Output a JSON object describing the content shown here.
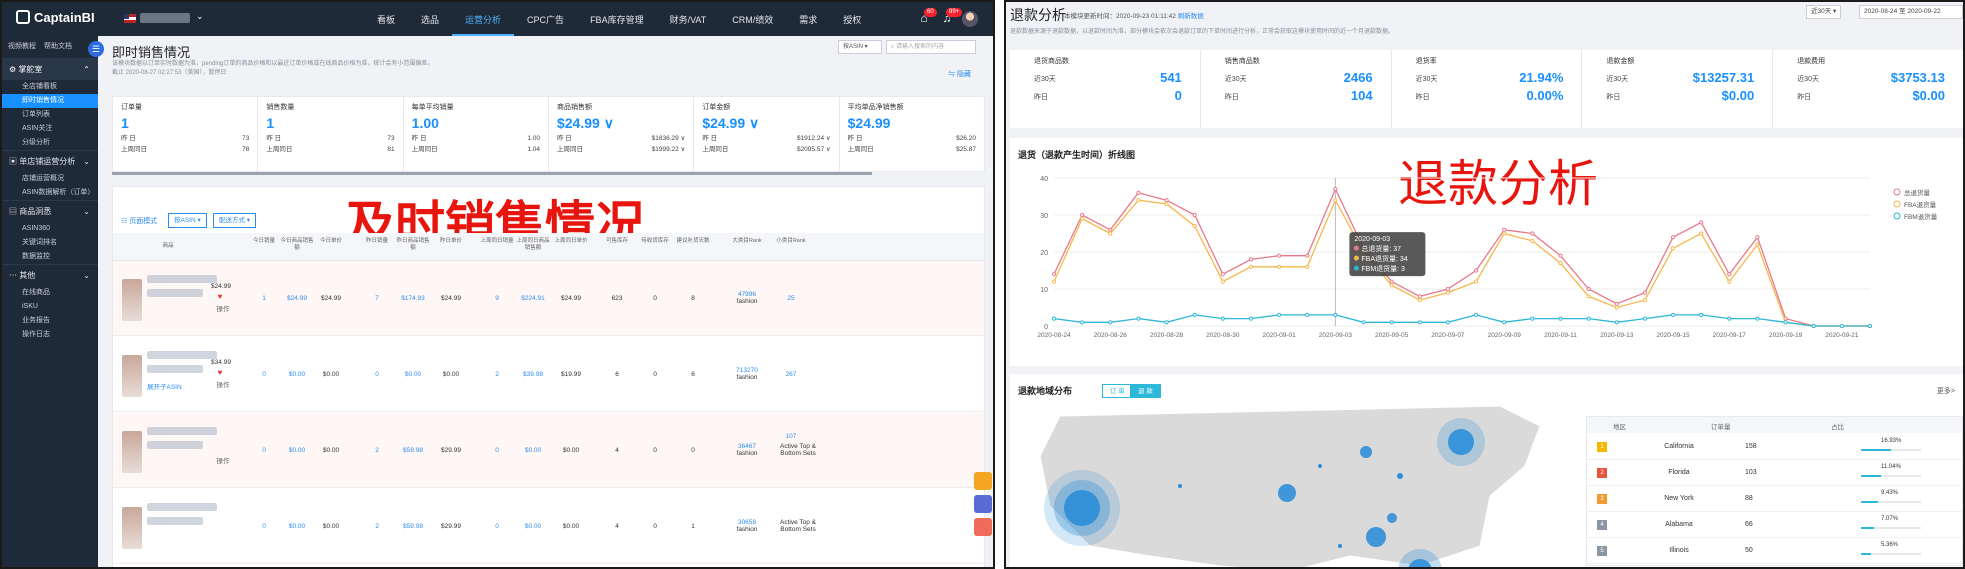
{
  "left": {
    "app": {
      "logo": "CaptainBI",
      "store": "████",
      "nav": [
        "看板",
        "选品",
        "运营分析",
        "CPC广告",
        "FBA库存管理",
        "财务/VAT",
        "CRM/绩效",
        "需求",
        "授权"
      ],
      "active_nav": "运营分析",
      "badge1": "60",
      "badge2": "99+"
    },
    "sidebar": {
      "top_links": [
        "视频教程",
        "帮助文档"
      ],
      "groups": [
        {
          "label": "掌舵室",
          "items": [
            "全店铺看板",
            "即时销售情况",
            "订单列表",
            "ASIN关注",
            "分级分析"
          ]
        },
        {
          "label": "单店铺运营分析",
          "items": [
            "店铺运营概况",
            "ASIN数据解析（订单）"
          ]
        },
        {
          "label": "商品洞悉",
          "items": [
            "ASIN360",
            "关键词排名",
            "数据监控"
          ]
        },
        {
          "label": "其他",
          "items": [
            "在线商品",
            "iSKU",
            "业务报告",
            "操作日志"
          ]
        }
      ],
      "active": "即时销售情况"
    },
    "page": {
      "title": "即时销售情况",
      "desc1": "该模块数据以订单实时数据为准，pending订单的商品价格和以最近订单价格或在线商品价格为准，统计会有小范围偏差。",
      "desc2": "截止 2020-08-27 02:27:53（美国），暂停日",
      "asin_select": "按ASIN",
      "search_placeholder": "请输入搜索的内容",
      "hide_label": "隐藏"
    },
    "kpis": [
      {
        "title": "订单量",
        "value": "1",
        "r1l": "昨 日",
        "r1v": "73",
        "r2l": "上周同日",
        "r2v": "78"
      },
      {
        "title": "销售数量",
        "value": "1",
        "r1l": "昨 日",
        "r1v": "73",
        "r2l": "上周同日",
        "r2v": "81"
      },
      {
        "title": "每单平均销量",
        "value": "1.00",
        "r1l": "昨 日",
        "r1v": "1.00",
        "r2l": "上周同日",
        "r2v": "1.04"
      },
      {
        "title": "商品销售额",
        "value": "$24.99 ∨",
        "r1l": "昨 日",
        "r1v": "$1836.29 ∨",
        "r2l": "上周同日",
        "r2v": "$1999.22 ∨"
      },
      {
        "title": "订单金额",
        "value": "$24.99 ∨",
        "r1l": "昨 日",
        "r1v": "$1912.24 ∨",
        "r2l": "上周同日",
        "r2v": "$2095.57 ∨"
      },
      {
        "title": "平均单品净销售额",
        "value": "$24.99",
        "r1l": "昨 日",
        "r1v": "$26.20",
        "r2l": "上周同日",
        "r2v": "$25.87"
      }
    ],
    "overlay": "及时销售情况",
    "table": {
      "btn_view": "页面模式",
      "btn_asin": "按ASIN ▾",
      "btn_ship": "配送方式 ▾",
      "headers": [
        "商品",
        "今日销量",
        "今日商品销售额",
        "今日单价",
        "昨日销量",
        "昨日商品销售额",
        "昨日单价",
        "上周同日销量",
        "上周同日商品销售额",
        "上周同日单价",
        "可售库存",
        "待收货库存",
        "建议补货天数",
        "大类目Rank",
        "小类目Rank"
      ],
      "rows": [
        {
          "price": "$24.99",
          "action": "操作",
          "cells": [
            "1",
            "$24.99",
            "$24.99",
            "7",
            "$174.93",
            "$24.99",
            "9",
            "$224.91",
            "$24.99",
            "623",
            "0",
            "8"
          ],
          "rank_big": "47996",
          "rank_big_cat": "fashion",
          "rank_small": "25",
          "extra": ""
        },
        {
          "price": "$34.99",
          "action": "操作",
          "cells": [
            "0",
            "$0.00",
            "$0.00",
            "0",
            "$0.00",
            "$0.00",
            "2",
            "$39.98",
            "$19.99",
            "6",
            "0",
            "6"
          ],
          "rank_big": "713270",
          "rank_big_cat": "fashion",
          "rank_small": "267",
          "extra": "展开子ASIN"
        },
        {
          "price": "",
          "action": "操作",
          "cells": [
            "0",
            "$0.00",
            "$0.00",
            "2",
            "$59.98",
            "$29.99",
            "0",
            "$0.00",
            "$0.00",
            "4",
            "0",
            "0"
          ],
          "rank_big": "36467",
          "rank_big_cat": "fashion",
          "rank_small": "107",
          "extra": "Active Top & Bottom Sets"
        },
        {
          "price": "",
          "action": "",
          "cells": [
            "0",
            "$0.00",
            "$0.00",
            "2",
            "$59.98",
            "$29.99",
            "0",
            "$0.00",
            "$0.00",
            "4",
            "0",
            "1"
          ],
          "rank_big": "30658",
          "rank_big_cat": "fashion",
          "rank_small": "",
          "extra": "Active Top & Bottom Sets"
        }
      ]
    }
  },
  "right": {
    "title": "退款分析",
    "update_label": "本模块更新时间：2020-09-23 01:11:42",
    "refresh": "刷新数据",
    "desc": "退款数据来源于退款数据，以退款时间为准，部分模块会依次会退款订单的下单时间进行分析，正常会获取这模块使用时间的近一个月退款数据。",
    "range_select": "近30天 ▾",
    "date_range": "2020-08-24 至 2020-09-22",
    "kpis": [
      {
        "title": "退货商品数",
        "l1": "近30天",
        "v1": "541",
        "l2": "昨日",
        "v2": "0"
      },
      {
        "title": "销售商品数",
        "l1": "近30天",
        "v1": "2466",
        "l2": "昨日",
        "v2": "104"
      },
      {
        "title": "退货率",
        "l1": "近30天",
        "v1": "21.94%",
        "l2": "昨日",
        "v2": "0.00%"
      },
      {
        "title": "退款金额",
        "l1": "近30天",
        "v1": "$13257.31",
        "l2": "昨日",
        "v2": "$0.00"
      },
      {
        "title": "退款费用",
        "l1": "近30天",
        "v1": "$3753.13",
        "l2": "昨日",
        "v2": "$0.00"
      }
    ],
    "chart_title": "退货（退款产生时间）折线图",
    "overlay": "退款分析",
    "tooltip": {
      "date": "2020-09-03",
      "l1": "总退货量: 37",
      "l2": "FBA退货量: 34",
      "l3": "FBM退货量: 3"
    },
    "map_title": "退款地域分布",
    "toggle": [
      "订 单",
      "退 款"
    ],
    "more": "更多>",
    "state_table": {
      "headers": [
        "地区",
        "订单量",
        "占比"
      ],
      "rows": [
        {
          "rank": "1",
          "state": "California",
          "orders": "158",
          "pct": "16.93%",
          "frac": 0.1693
        },
        {
          "rank": "2",
          "state": "Florida",
          "orders": "103",
          "pct": "11.04%",
          "frac": 0.1104
        },
        {
          "rank": "3",
          "state": "New York",
          "orders": "88",
          "pct": "9.43%",
          "frac": 0.0943
        },
        {
          "rank": "4",
          "state": "Alabama",
          "orders": "66",
          "pct": "7.07%",
          "frac": 0.0707
        },
        {
          "rank": "5",
          "state": "Illinois",
          "orders": "50",
          "pct": "5.36%",
          "frac": 0.0536
        }
      ]
    }
  },
  "chart_data": {
    "type": "line",
    "title": "退货（退款产生时间）折线图",
    "x": [
      "2020-08-24",
      "2020-08-25",
      "2020-08-26",
      "2020-08-27",
      "2020-08-28",
      "2020-08-29",
      "2020-08-30",
      "2020-08-31",
      "2020-09-01",
      "2020-09-02",
      "2020-09-03",
      "2020-09-04",
      "2020-09-05",
      "2020-09-06",
      "2020-09-07",
      "2020-09-08",
      "2020-09-09",
      "2020-09-10",
      "2020-09-11",
      "2020-09-12",
      "2020-09-13",
      "2020-09-14",
      "2020-09-15",
      "2020-09-16",
      "2020-09-17",
      "2020-09-18",
      "2020-09-19",
      "2020-09-20",
      "2020-09-21",
      "2020-09-22"
    ],
    "xticks": [
      "2020-08-24",
      "2020-08-26",
      "2020-08-28",
      "2020-08-30",
      "2020-09-01",
      "2020-09-03",
      "2020-09-05",
      "2020-09-07",
      "2020-09-09",
      "2020-09-11",
      "2020-09-13",
      "2020-09-15",
      "2020-09-17",
      "2020-09-19",
      "2020-09-21"
    ],
    "ylim": [
      0,
      40
    ],
    "yticks": [
      0,
      10,
      20,
      30,
      40
    ],
    "series": [
      {
        "name": "总退货量",
        "color": "#e8788a",
        "values": [
          14,
          30,
          26,
          36,
          34,
          30,
          14,
          18,
          19,
          19,
          37,
          21,
          12,
          8,
          10,
          15,
          26,
          25,
          19,
          10,
          6,
          9,
          24,
          28,
          14,
          24,
          2,
          0,
          0,
          0
        ]
      },
      {
        "name": "FBA退货量",
        "color": "#f5b84c",
        "values": [
          12,
          29,
          25,
          34,
          33,
          27,
          12,
          16,
          16,
          16,
          34,
          20,
          11,
          7,
          9,
          12,
          25,
          23,
          17,
          8,
          5,
          7,
          21,
          25,
          12,
          22,
          1,
          0,
          0,
          0
        ]
      },
      {
        "name": "FBM退货量",
        "color": "#2db7d8",
        "values": [
          2,
          1,
          1,
          2,
          1,
          3,
          2,
          2,
          3,
          3,
          3,
          1,
          1,
          1,
          1,
          3,
          1,
          2,
          2,
          2,
          1,
          2,
          3,
          3,
          2,
          2,
          1,
          0,
          0,
          0
        ]
      }
    ]
  }
}
